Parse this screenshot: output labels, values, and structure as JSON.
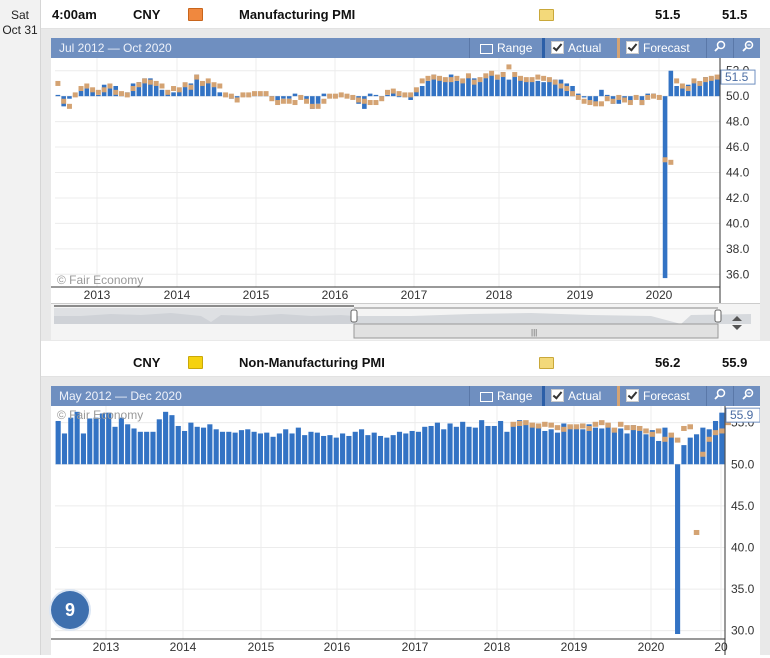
{
  "event_day": {
    "weekday": "Sat",
    "date": "Oct 31"
  },
  "events": [
    {
      "time": "4:00am",
      "currency": "CNY",
      "impact_color": "#f0883e",
      "title": "Manufacturing PMI",
      "actual": "51.5",
      "forecast": "51.5"
    },
    {
      "time": "",
      "currency": "CNY",
      "impact_color": "#f5d20f",
      "title": "Non-Manufacturing PMI",
      "actual": "56.2",
      "forecast": "55.9"
    }
  ],
  "toolbar": {
    "range_label": "Range",
    "actual_label": "Actual",
    "forecast_label": "Forecast",
    "search_icon": "magnifier-icon",
    "zoom_out_icon": "zoom-out-icon"
  },
  "colors": {
    "actual_bar": "#3373c4",
    "forecast_marker": "#d4a373",
    "toolbar": "#6f8fc0"
  },
  "badge": "9",
  "chart_data": [
    {
      "type": "bar",
      "title": "Manufacturing PMI",
      "range_label": "Jul 2012 — Oct 2020",
      "watermark": "© Fair Economy",
      "baseline": 50.0,
      "ylim": [
        35.0,
        53.0
      ],
      "yticks": [
        "52.0",
        "50.0",
        "48.0",
        "46.0",
        "44.0",
        "42.0",
        "40.0",
        "38.0",
        "36.0"
      ],
      "ytick_values": [
        52,
        50,
        48,
        46,
        44,
        42,
        40,
        38,
        36
      ],
      "xticks": [
        "2013",
        "2014",
        "2015",
        "2016",
        "2017",
        "2018",
        "2019",
        "2020"
      ],
      "latest_label": "51.5",
      "start": "2012-07",
      "actual": [
        50.1,
        49.2,
        49.8,
        50.2,
        50.6,
        50.6,
        50.4,
        50.1,
        50.9,
        50.6,
        50.8,
        50.1,
        50.3,
        51.0,
        51.1,
        51.4,
        51.4,
        51.0,
        50.5,
        50.2,
        50.3,
        50.4,
        50.8,
        51.0,
        51.7,
        51.1,
        51.1,
        50.8,
        50.3,
        50.1,
        49.8,
        49.9,
        50.1,
        50.1,
        50.2,
        50.2,
        50.2,
        49.7,
        49.6,
        49.8,
        49.8,
        50.2,
        50.0,
        49.7,
        49.0,
        49.4,
        50.2,
        50.1,
        50.0,
        50.2,
        49.9,
        49.8,
        49.4,
        49.0,
        50.2,
        50.1,
        50.0,
        50.1,
        50.4,
        50.0,
        50.0,
        49.7,
        50.4,
        50.8,
        51.2,
        51.7,
        51.4,
        51.4,
        51.7,
        51.2,
        51.2,
        51.7,
        51.4,
        51.4,
        51.6,
        51.7,
        51.3,
        51.9,
        51.3,
        51.6,
        51.5,
        51.2,
        51.4,
        51.2,
        51.1,
        51.4,
        51.3,
        51.3,
        51.0,
        50.8,
        50.2,
        49.9,
        49.4,
        49.5,
        50.5,
        50.1,
        49.4,
        49.4,
        49.7,
        49.5,
        49.8,
        49.3,
        50.2,
        50.2,
        50.0,
        35.7,
        52.0,
        50.8,
        50.6,
        50.9,
        51.1,
        51.1,
        51.5,
        51.5,
        51.5
      ],
      "forecast": [
        51.0,
        49.6,
        49.2,
        50.1,
        50.6,
        50.8,
        50.5,
        50.3,
        50.5,
        50.8,
        50.3,
        50.2,
        50.1,
        50.6,
        50.9,
        51.2,
        51.1,
        51.0,
        50.8,
        50.3,
        50.6,
        50.5,
        50.9,
        50.7,
        51.5,
        51.0,
        51.2,
        50.9,
        50.8,
        50.1,
        50.0,
        49.7,
        50.1,
        50.1,
        50.2,
        50.2,
        50.2,
        49.8,
        49.5,
        49.6,
        49.6,
        49.5,
        49.9,
        49.6,
        49.2,
        49.2,
        49.6,
        50.0,
        50.0,
        50.1,
        50.0,
        49.9,
        49.7,
        49.6,
        49.5,
        49.5,
        49.8,
        50.3,
        50.4,
        50.2,
        50.1,
        50.1,
        50.5,
        51.2,
        51.4,
        51.5,
        51.4,
        51.3,
        51.3,
        51.4,
        51.2,
        51.6,
        51.1,
        51.3,
        51.6,
        51.8,
        51.5,
        51.7,
        52.3,
        51.7,
        51.4,
        51.3,
        51.3,
        51.5,
        51.4,
        51.3,
        51.1,
        50.8,
        50.6,
        50.2,
        49.9,
        49.6,
        49.5,
        49.4,
        49.4,
        49.8,
        49.6,
        49.9,
        49.7,
        49.5,
        49.9,
        49.5,
        49.9,
        50.0,
        49.9,
        45.0,
        44.8,
        51.2,
        50.8,
        50.6,
        51.2,
        51.0,
        51.3,
        51.4,
        51.5
      ],
      "bar_color": "#3373c4",
      "forecast_color": "#d4a373"
    },
    {
      "type": "bar",
      "title": "Non-Manufacturing PMI",
      "range_label": "May 2012 — Dec 2020",
      "watermark": "© Fair Economy",
      "baseline": 50.0,
      "ylim": [
        29.0,
        57.0
      ],
      "yticks": [
        "55.0",
        "50.0",
        "45.0",
        "40.0",
        "35.0",
        "30.0"
      ],
      "ytick_values": [
        55,
        50,
        45,
        40,
        35,
        30
      ],
      "xticks": [
        "2013",
        "2014",
        "2015",
        "2016",
        "2017",
        "2018",
        "2019",
        "2020",
        "20"
      ],
      "latest_label": "55.9",
      "start": "2012-05",
      "actual": [
        55.2,
        53.7,
        55.6,
        56.3,
        53.7,
        55.5,
        55.6,
        56.1,
        56.2,
        54.5,
        55.6,
        54.8,
        54.3,
        53.9,
        53.9,
        53.9,
        55.4,
        56.3,
        55.9,
        54.6,
        54.0,
        55.0,
        54.5,
        54.4,
        54.8,
        54.2,
        53.9,
        53.9,
        53.8,
        54.1,
        54.2,
        53.9,
        53.7,
        53.8,
        53.3,
        53.7,
        54.2,
        53.7,
        54.4,
        53.5,
        53.9,
        53.8,
        53.4,
        53.5,
        53.2,
        53.7,
        53.4,
        53.9,
        54.2,
        53.5,
        53.8,
        53.4,
        53.2,
        53.5,
        53.9,
        53.7,
        54.0,
        53.9,
        54.5,
        54.6,
        55.0,
        54.2,
        54.9,
        54.5,
        55.1,
        54.5,
        54.4,
        55.3,
        54.6,
        54.6,
        55.2,
        53.9,
        55.0,
        55.3,
        54.8,
        54.9,
        54.6,
        54.0,
        54.2,
        53.8,
        54.9,
        54.6,
        54.3,
        54.2,
        54.8,
        54.4,
        54.3,
        54.8,
        54.2,
        54.3,
        53.7,
        54.7,
        54.3,
        53.6,
        54.1,
        52.8,
        54.4,
        53.5,
        29.6,
        52.3,
        53.2,
        53.6,
        54.4,
        54.2,
        55.2,
        56.2
      ],
      "forecast": [
        null,
        null,
        null,
        null,
        null,
        null,
        null,
        null,
        null,
        null,
        null,
        null,
        null,
        null,
        null,
        null,
        null,
        null,
        null,
        null,
        null,
        null,
        null,
        null,
        null,
        null,
        null,
        null,
        null,
        null,
        null,
        null,
        null,
        null,
        null,
        null,
        null,
        null,
        null,
        null,
        null,
        null,
        null,
        null,
        null,
        null,
        null,
        null,
        null,
        null,
        null,
        null,
        null,
        null,
        null,
        null,
        null,
        null,
        null,
        null,
        null,
        null,
        null,
        null,
        null,
        null,
        null,
        null,
        null,
        null,
        null,
        null,
        54.8,
        54.9,
        55.0,
        54.7,
        54.6,
        54.8,
        54.7,
        54.4,
        54.2,
        54.5,
        54.5,
        54.6,
        54.3,
        54.8,
        55.0,
        54.7,
        54.1,
        54.8,
        54.4,
        54.4,
        54.3,
        54.0,
        53.6,
        54.0,
        53.0,
        53.5,
        52.9,
        54.3,
        54.5,
        41.8,
        51.2,
        53.0,
        53.8,
        54.0,
        55.0,
        55.9
      ],
      "bar_color": "#3373c4",
      "forecast_color": "#d4a373"
    }
  ]
}
